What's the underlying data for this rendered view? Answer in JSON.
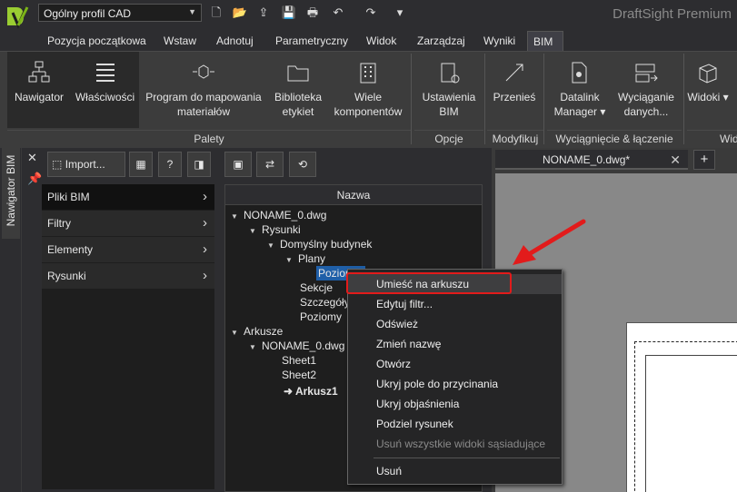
{
  "app": {
    "title": "DraftSight Premium",
    "profile": "Ogólny profil CAD"
  },
  "menu": {
    "tabs": [
      "Pozycja początkowa",
      "Wstaw",
      "Adnotuj",
      "Parametryczny",
      "Widok",
      "Zarządzaj",
      "Wyniki",
      "BIM"
    ],
    "active": "BIM"
  },
  "ribbon": {
    "buttons": [
      {
        "label": "Nawigator"
      },
      {
        "label": "Właściwości"
      },
      {
        "label": "Program do mapowania materiałów"
      },
      {
        "label": "Biblioteka etykiet"
      },
      {
        "label": "Wiele komponentów"
      },
      {
        "label": "Ustawienia BIM"
      },
      {
        "label": "Przenieś"
      },
      {
        "label": "Datalink Manager ▾"
      },
      {
        "label": "Wyciąganie danych..."
      },
      {
        "label": "Widoki ▾"
      }
    ],
    "groups": [
      "Palety",
      "Opcje",
      "Modyfikuj",
      "Wyciągnięcie & łączenie",
      "Wid"
    ]
  },
  "side": {
    "tab_label": "Nawigator BIM"
  },
  "panel": {
    "import_label": "Import...",
    "help_label": "?",
    "nav_items": [
      "Pliki BIM",
      "Filtry",
      "Elementy",
      "Rysunki"
    ]
  },
  "tree": {
    "header": "Nazwa",
    "nodes": [
      "NONAME_0.dwg",
      "Rysunki",
      "Domyślny budynek",
      "Plany",
      "Poziom 1",
      "Sekcje",
      "Szczegóły",
      "Poziomy",
      "Arkusze",
      "NONAME_0.dwg",
      "Sheet1",
      "Sheet2",
      "Arkusz1"
    ]
  },
  "document": {
    "tab_label": "NONAME_0.dwg*",
    "close_glyph": "✕",
    "add_glyph": "+"
  },
  "context_menu": {
    "items": [
      {
        "label": "Umieść na arkuszu",
        "enabled": true
      },
      {
        "label": "Edytuj filtr...",
        "enabled": true
      },
      {
        "label": "Odśwież",
        "enabled": true
      },
      {
        "label": "Zmień nazwę",
        "enabled": true
      },
      {
        "label": "Otwórz",
        "enabled": true
      },
      {
        "label": "Ukryj pole do przycinania",
        "enabled": true
      },
      {
        "label": "Ukryj objaśnienia",
        "enabled": true
      },
      {
        "label": "Podziel rysunek",
        "enabled": true
      },
      {
        "label": "Usuń wszystkie widoki sąsiadujące",
        "enabled": false
      },
      {
        "label": "Usuń",
        "enabled": true
      }
    ],
    "highlight_color": "#e21b1b"
  }
}
